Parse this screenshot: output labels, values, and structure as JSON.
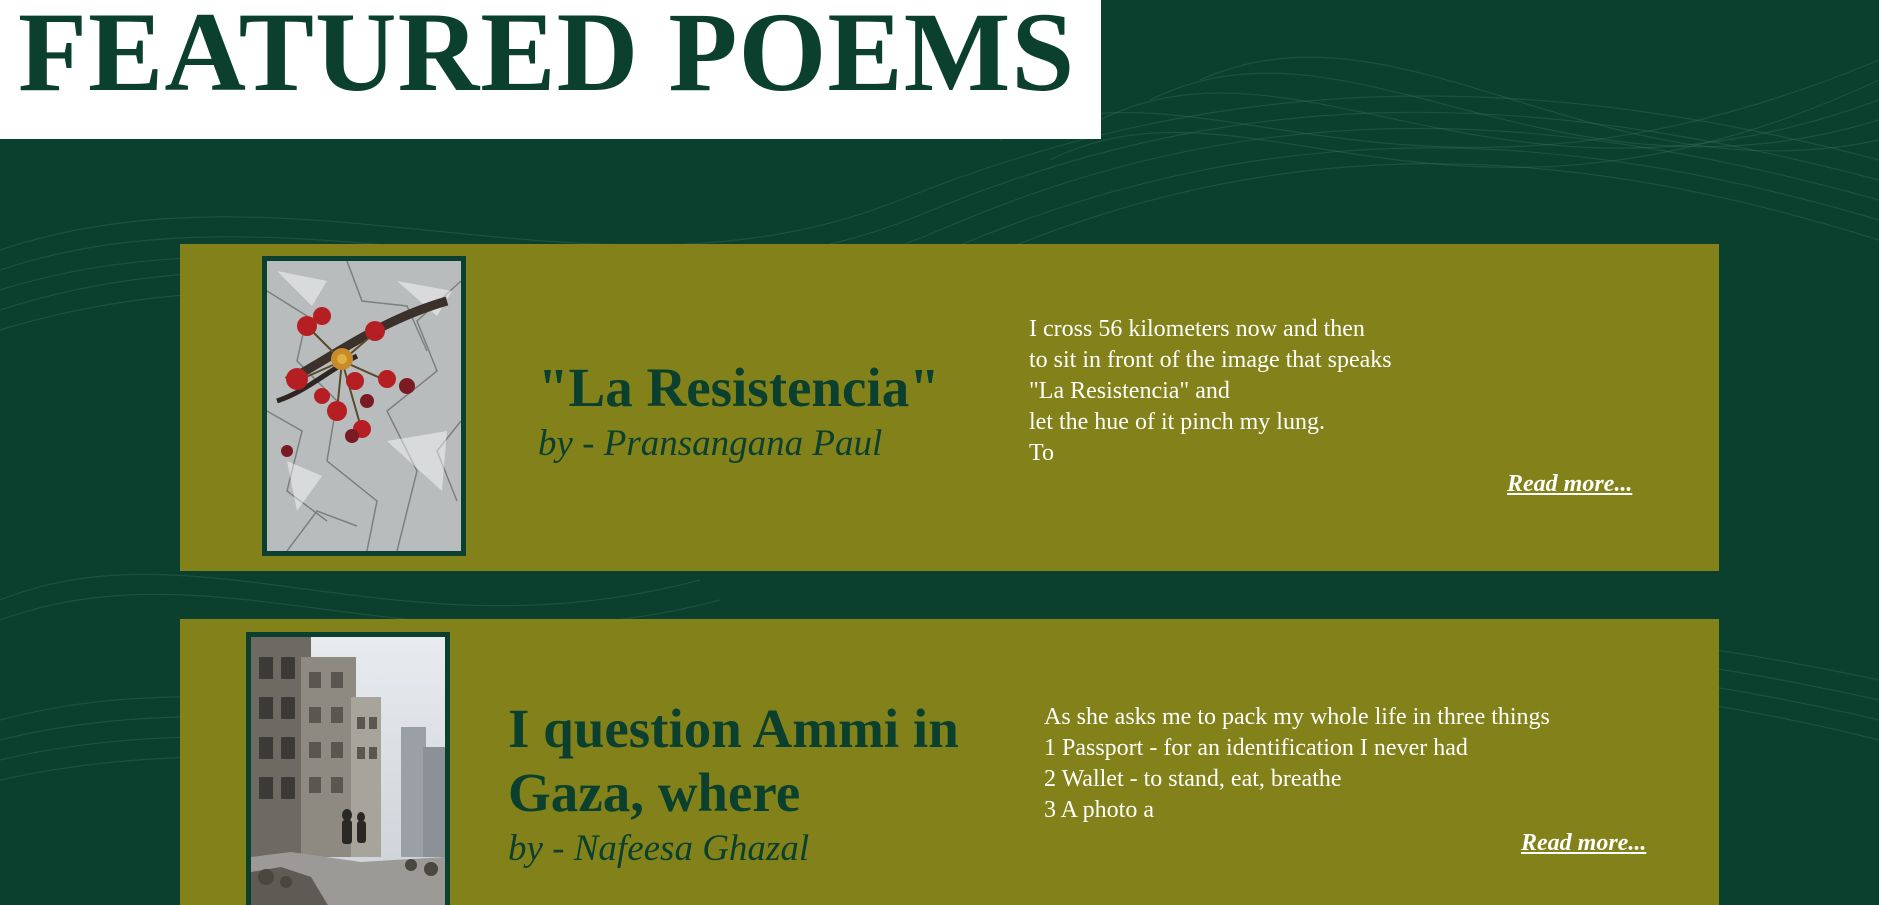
{
  "page": {
    "title": "FEATURED POEMS"
  },
  "colors": {
    "background": "#0b3f2e",
    "card": "#83821a",
    "title_box": "#ffffff",
    "heading_text": "#0b3f2e",
    "excerpt_text": "#ffffff"
  },
  "poems": [
    {
      "title": "\"La Resistencia\"",
      "author": "by - Pransangana Paul",
      "image": "red-flowers-on-stone-image",
      "excerpt_lines": [
        "I cross 56 kilometers now and then",
        "to sit in front of the image that speaks",
        "\"La Resistencia\" and",
        "let the hue of it pinch my lung.",
        "To"
      ],
      "read_more": "Read more..."
    },
    {
      "title": "I question Ammi in Gaza, where",
      "author": "by - Nafeesa Ghazal",
      "image": "ruined-street-buildings-image",
      "excerpt_lines": [
        "As she asks me to pack my whole life in three things",
        "1 Passport - for an identification I never had",
        "2 Wallet - to stand, eat, breathe",
        "3 A photo a"
      ],
      "read_more": "Read more..."
    }
  ]
}
